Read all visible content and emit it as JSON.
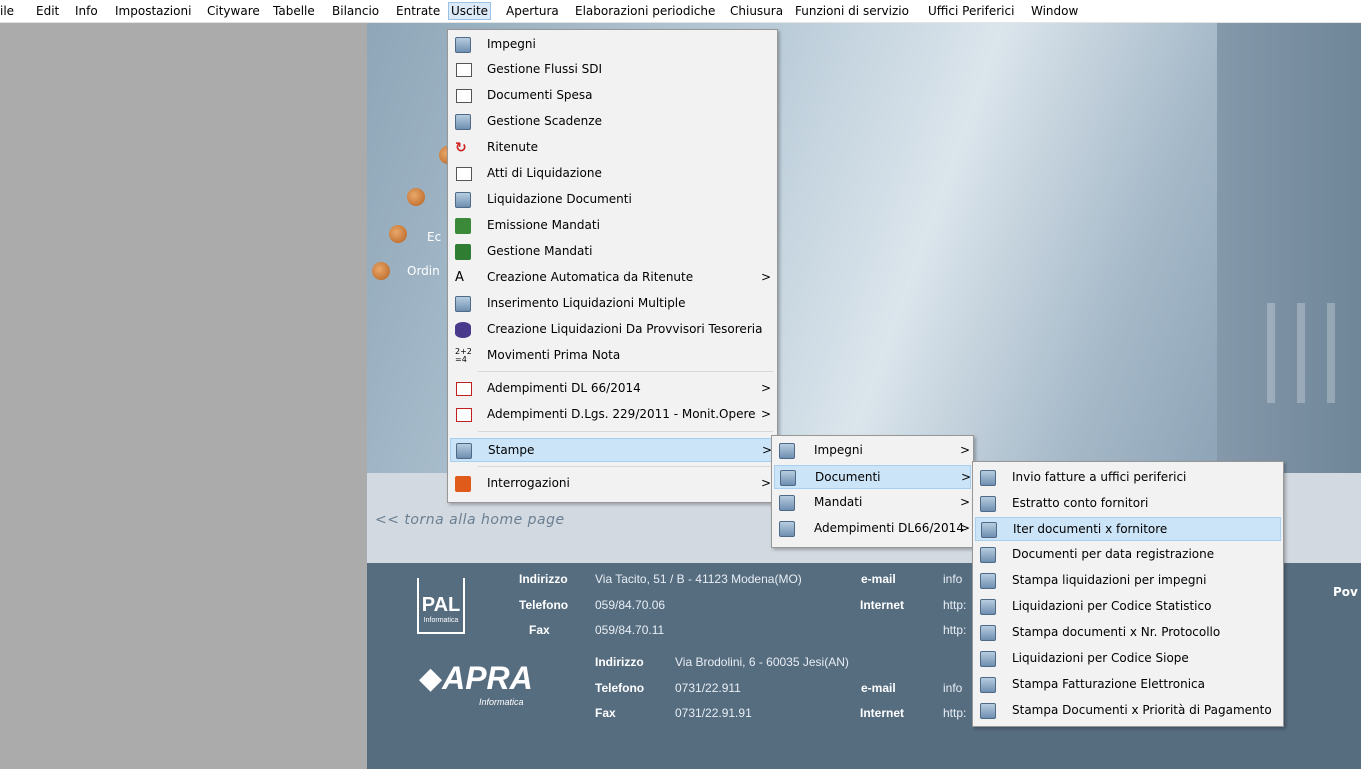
{
  "menubar": {
    "items": [
      "ile",
      "Edit",
      "Info",
      "Impostazioni",
      "Cityware",
      "Tabelle",
      "Bilancio",
      "Entrate",
      "Uscite",
      "Apertura",
      "Elaborazioni periodiche",
      "Chiusura",
      "Funzioni di servizio",
      "Uffici Periferici",
      "Window"
    ],
    "active": "Uscite"
  },
  "banner": {
    "items": [
      "Ec",
      "Ordin"
    ],
    "home_link": "<< torna alla home page",
    "right_text": "Pov"
  },
  "footer": {
    "pal": {
      "logo": "PAL",
      "sub": "Informatica",
      "labels": [
        "Indirizzo",
        "Telefono",
        "Fax"
      ],
      "values": [
        "Via Tacito, 51 / B - 41123 Modena(MO)",
        "059/84.70.06",
        "059/84.70.11"
      ],
      "labels2": [
        "e-mail",
        "Internet"
      ],
      "values2": [
        "info",
        "http:",
        "http:"
      ]
    },
    "apra": {
      "logo": "APRA",
      "sub": "Informatica",
      "labels": [
        "Indirizzo",
        "Telefono",
        "Fax"
      ],
      "values": [
        "Via Brodolini, 6 - 60035 Jesi(AN)",
        "0731/22.911",
        "0731/22.91.91"
      ],
      "labels2": [
        "e-mail",
        "Internet"
      ],
      "values2": [
        "info",
        "http:"
      ]
    }
  },
  "uscite_menu": {
    "items": [
      {
        "label": "Impegni",
        "icon": "impegni-icon"
      },
      {
        "label": "Gestione Flussi SDI",
        "icon": "form-icon"
      },
      {
        "label": "Documenti Spesa",
        "icon": "form-icon"
      },
      {
        "label": "Gestione Scadenze",
        "icon": "calendar-icon"
      },
      {
        "label": "Ritenute",
        "icon": "refresh-icon"
      },
      {
        "label": "Atti di Liquidazione",
        "icon": "folder-icon"
      },
      {
        "label": "Liquidazione Documenti",
        "icon": "doc-check-icon"
      },
      {
        "label": "Emissione Mandati",
        "icon": "mandate-icon"
      },
      {
        "label": "Gestione Mandati",
        "icon": "money-icon"
      },
      {
        "label": "Creazione Automatica da Ritenute",
        "icon": "auto-icon",
        "submenu": true
      },
      {
        "label": "Inserimento Liquidazioni Multiple",
        "icon": "doc-check-icon"
      },
      {
        "label": "Creazione Liquidazioni Da Provvisori Tesoreria",
        "icon": "database-icon"
      },
      {
        "label": "Movimenti Prima Nota",
        "icon": "math-icon"
      },
      {
        "label": "Adempimenti DL 66/2014",
        "icon": "ledger-icon",
        "submenu": true
      },
      {
        "label": "Adempimenti D.Lgs. 229/2011 - Monit.Opere",
        "icon": "ledger-icon",
        "submenu": true
      },
      {
        "label": "Stampe",
        "icon": "print-icon",
        "submenu": true
      },
      {
        "label": "Interrogazioni",
        "icon": "query-icon",
        "submenu": true
      }
    ]
  },
  "stampe_menu": {
    "items": [
      {
        "label": "Impegni",
        "submenu": true
      },
      {
        "label": "Documenti",
        "submenu": true
      },
      {
        "label": "Mandati",
        "submenu": true
      },
      {
        "label": "Adempimenti DL66/2014",
        "submenu": true
      }
    ]
  },
  "documenti_menu": {
    "items": [
      "Invio fatture a uffici periferici",
      "Estratto conto fornitori",
      "Iter documenti x fornitore",
      "Documenti per data registrazione",
      "Stampa liquidazioni per impegni",
      "Liquidazioni per Codice Statistico",
      "Stampa documenti x Nr. Protocollo",
      "Liquidazioni per Codice Siope",
      "Stampa Fatturazione Elettronica",
      "Stampa Documenti x Priorità di Pagamento"
    ]
  },
  "arrow": ">",
  "colors": {
    "highlight": "#cce4f7",
    "footer": "#566d80",
    "menu_bg": "#f2f2f2"
  }
}
